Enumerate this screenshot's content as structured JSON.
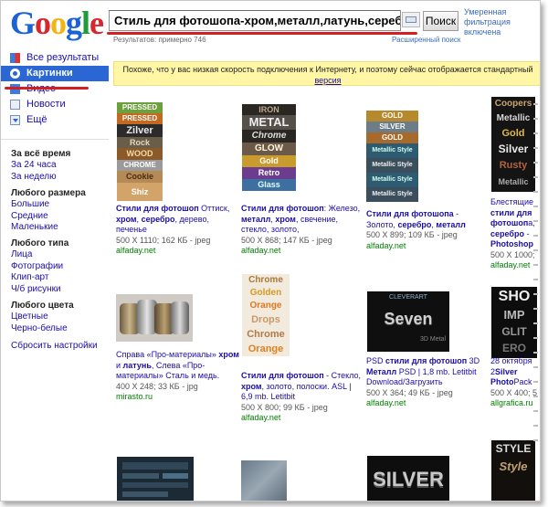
{
  "logo": "Google",
  "search": {
    "value": "Стиль для фотошопа-хром,металл,латунь,серебро",
    "button": "Поиск"
  },
  "safesearch": "Умеренная фильтрация включена",
  "stats": "Результатов: примерно 746",
  "advanced": "Расширенный поиск",
  "nav": [
    {
      "label": "Все результаты",
      "icon": "web-results-icon"
    },
    {
      "label": "Картинки",
      "icon": "images-icon",
      "active": true
    },
    {
      "label": "Видео",
      "icon": "video-icon"
    },
    {
      "label": "Новости",
      "icon": "news-icon"
    },
    {
      "label": "Ещё",
      "icon": "more-icon"
    }
  ],
  "filters": {
    "time": {
      "heading": "За всё время",
      "items": [
        "За 24 часа",
        "За неделю"
      ]
    },
    "size": {
      "heading": "Любого размера",
      "items": [
        "Большие",
        "Средние",
        "Маленькие"
      ]
    },
    "type": {
      "heading": "Любого типа",
      "items": [
        "Лица",
        "Фотографии",
        "Клип-арт",
        "Ч/б рисунки"
      ]
    },
    "color": {
      "heading": "Любого цвета",
      "items": [
        "Цветные",
        "Черно-белые"
      ]
    },
    "reset": "Сбросить настройки"
  },
  "banner": {
    "text": "Похоже, что у вас низкая скорость подключения к Интернету, и поэтому сейчас отображается стандартный",
    "link": "версия"
  },
  "results": [
    {
      "pre": "",
      "bold1": "Стили для фотошоп",
      "rest": " Оттиск, ",
      "bold2": "хром",
      "rest2": ", ",
      "bold3": "серебро",
      "rest3": ", дерево, печенье",
      "meta": "500 X 1110; 162 КБ - jpeg",
      "url": "alfaday.net",
      "thumb_texts": [
        "PRESSED",
        "PRESSED",
        "Zilver",
        "Rock",
        "WOOD",
        "CHROME",
        "Cookie",
        "Shiz"
      ]
    },
    {
      "pre": "",
      "bold1": "Стили для фотошоп",
      "rest": ": Железо, ",
      "bold2": "металл",
      "rest2": ", ",
      "bold3": "хром",
      "rest3": ", свечение, стекло, золото,",
      "meta": "500 X 868; 147 КБ - jpeg",
      "url": "alfaday.net",
      "thumb_texts": [
        "IRON",
        "METAL",
        "Chrome",
        "GLOW",
        "Gold",
        "Retro",
        "Glass"
      ]
    },
    {
      "pre": "",
      "bold1": "Стили для фотошопа",
      "rest": " - Золото, ",
      "bold2": "серебро",
      "rest2": ", ",
      "bold3": "металл",
      "rest3": "",
      "meta": "500 X 899; 109 КБ - jpeg",
      "url": "alfaday.net",
      "thumb_texts": [
        "GOLD",
        "SILVER",
        "GOLD",
        "Metallic Style",
        "Metallic Style",
        "Metallic Style",
        "Metallic Style"
      ]
    },
    {
      "pre": "Блестящие ",
      "bold1": "стили для фотошоп",
      "rest": "а, ",
      "bold2": "серебро",
      "rest2": " - ",
      "bold3": "Photoshop",
      "rest3": "",
      "meta": "500 X 1000;",
      "url": "alfaday.net",
      "thumb_texts": [
        "Coopers",
        "Metallic",
        "Gold",
        "Silver",
        "Rusty",
        "Metallic"
      ]
    },
    {
      "pre": "Справа «Про-материалы» ",
      "bold1": "хром",
      "rest": " и ",
      "bold2": "латунь",
      "rest2": ", Слева «Про-материалы» Сталь и медь.",
      "bold3": "",
      "rest3": "",
      "meta": "400 X 248; 33 КБ - jpg",
      "url": "mirasto.ru",
      "thumb_texts": []
    },
    {
      "pre": "",
      "bold1": "Стили для фотошоп",
      "rest": " - Стекло, ",
      "bold2": "хром",
      "rest2": ", золото, полоски. ASL | 6,9 mb. Letitbit",
      "bold3": "",
      "rest3": "",
      "meta": "500 X 800; 99 КБ - jpeg",
      "url": "alfaday.net",
      "thumb_texts": [
        "Chrome",
        "Golden",
        "Orange",
        "Drops",
        "Chrome",
        "Orange"
      ]
    },
    {
      "pre": "PSD ",
      "bold1": "стили для фотошоп",
      "rest": " 3D ",
      "bold2": "Металл",
      "rest2": " PSD | 1,8 mb. Letitbit Download/Загрузить",
      "bold3": "",
      "rest3": "",
      "meta": "500 X 364; 49 КБ - jpeg",
      "url": "alfaday.net",
      "thumb_texts": [
        "CLEVERART",
        "Seven",
        "3D Metal"
      ]
    },
    {
      "pre": "28 октября 2",
      "bold1": "Silver Photo",
      "rest": "Pack",
      "bold2": "",
      "rest2": "",
      "bold3": "",
      "rest3": "",
      "meta": "500 X 400; 5",
      "url": "allgrafica.ru",
      "thumb_texts": [
        "SHO",
        "IMP",
        "GLIT",
        "ERO"
      ]
    }
  ],
  "bottom_thumbs": [
    "SILVER",
    "STYLE",
    "Style"
  ]
}
